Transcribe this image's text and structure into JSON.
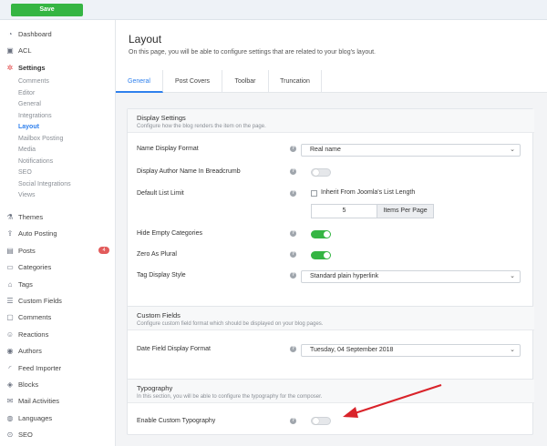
{
  "toolbar": {
    "save_label": "Save"
  },
  "sidebar": {
    "top_items": [
      {
        "label": "Dashboard",
        "icon": "dashboard-icon"
      },
      {
        "label": "ACL",
        "icon": "lock-icon"
      }
    ],
    "settings": {
      "label": "Settings",
      "icon": "gear-icon",
      "children": [
        "Comments",
        "Editor",
        "General",
        "Integrations",
        "Layout",
        "Mailbox Posting",
        "Media",
        "Notifications",
        "SEO",
        "Social Integrations",
        "Views"
      ],
      "active_child": "Layout"
    },
    "items": [
      {
        "label": "Themes",
        "icon": "flask-icon"
      },
      {
        "label": "Auto Posting",
        "icon": "share-icon"
      },
      {
        "label": "Posts",
        "icon": "document-icon",
        "badge": "4"
      },
      {
        "label": "Categories",
        "icon": "folder-icon"
      },
      {
        "label": "Tags",
        "icon": "tag-icon"
      },
      {
        "label": "Custom Fields",
        "icon": "list-icon"
      },
      {
        "label": "Comments",
        "icon": "comment-icon"
      },
      {
        "label": "Reactions",
        "icon": "smile-icon"
      },
      {
        "label": "Authors",
        "icon": "user-icon"
      },
      {
        "label": "Feed Importer",
        "icon": "rss-icon"
      },
      {
        "label": "Blocks",
        "icon": "cube-icon"
      },
      {
        "label": "Mail Activities",
        "icon": "mail-icon"
      },
      {
        "label": "Languages",
        "icon": "globe-icon"
      },
      {
        "label": "SEO",
        "icon": "search-icon"
      }
    ]
  },
  "header": {
    "title": "Layout",
    "description": "On this page, you will be able to configure settings that are related to your blog's layout."
  },
  "tabs": [
    "General",
    "Post Covers",
    "Toolbar",
    "Truncation"
  ],
  "active_tab": "General",
  "display_settings": {
    "title": "Display Settings",
    "subtitle": "Configure how the blog renders the item on the page.",
    "name_display_format": {
      "label": "Name Display Format",
      "value": "Real name"
    },
    "author_breadcrumb": {
      "label": "Display Author Name In Breadcrumb",
      "on": false
    },
    "default_list_limit": {
      "label": "Default List Limit",
      "inherit_label": "Inherit From Joomla's List Length",
      "inherit_checked": false,
      "value": "5",
      "addon": "Items Per Page"
    },
    "hide_empty_categories": {
      "label": "Hide Empty Categories",
      "on": true
    },
    "zero_as_plural": {
      "label": "Zero As Plural",
      "on": true
    },
    "tag_display_style": {
      "label": "Tag Display Style",
      "value": "Standard plain hyperlink"
    }
  },
  "custom_fields": {
    "title": "Custom Fields",
    "subtitle": "Configure custom field format which should be displayed on your blog pages.",
    "date_format": {
      "label": "Date Field Display Format",
      "value": "Tuesday, 04 September 2018"
    }
  },
  "typography": {
    "title": "Typography",
    "subtitle": "In this section, you will be able to configure the typography for the composer.",
    "enable_custom": {
      "label": "Enable Custom Typography",
      "on": false
    }
  },
  "colors": {
    "accent": "#2f80ed",
    "save": "#35b543",
    "toggle_on": "#35b543",
    "arrow": "#d9232a",
    "badge": "#e25b5b"
  }
}
